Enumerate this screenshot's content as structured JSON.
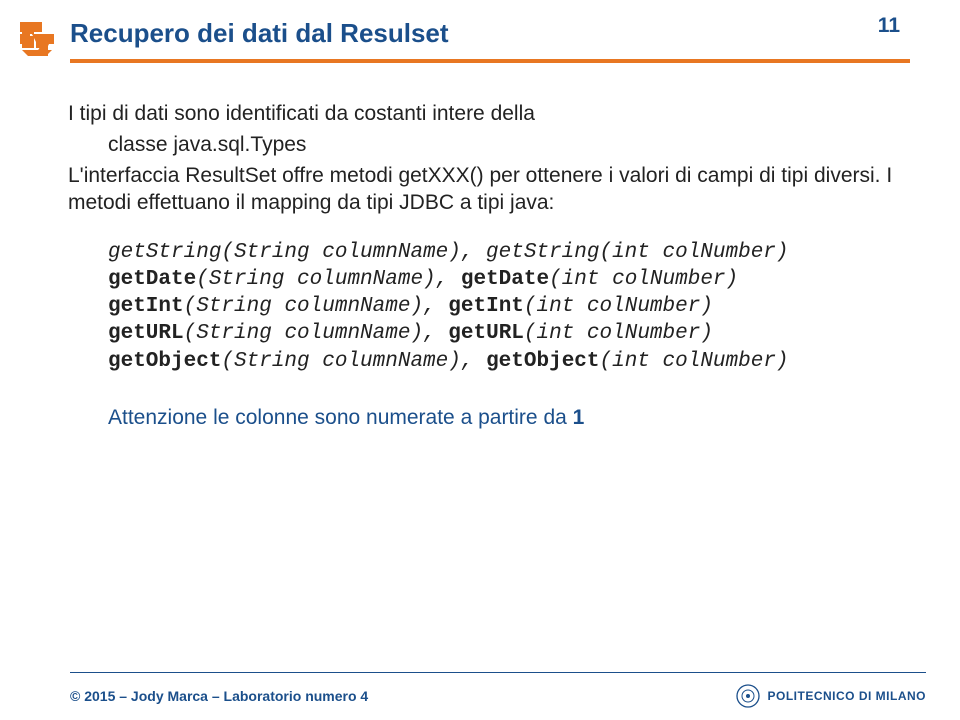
{
  "header": {
    "title": "Recupero dei dati dal Resulset",
    "page_number": "11"
  },
  "content": {
    "intro1": "I tipi di dati sono identificati da costanti intere della",
    "intro2": "classe java.sql.Types",
    "intro3": "L'interfaccia ResultSet offre metodi getXXX() per ottenere i valori di campi di tipi diversi. I metodi effettuano il mapping da tipi JDBC a tipi java:",
    "code": {
      "l1a": "getString(String columnName), getString(int colNumber)",
      "l2_pre": "getDate",
      "l2_mid": "(String columnName), ",
      "l2_b2": "getDate",
      "l2_end": "(int colNumber)",
      "l3_pre": "getInt",
      "l3_mid": "(String columnName), ",
      "l3_b2": "getInt",
      "l3_end": "(int colNumber)",
      "l4_pre": "getURL",
      "l4_mid": "(String columnName), ",
      "l4_b2": "getURL",
      "l4_end": "(int colNumber)",
      "l5_pre": "getObject",
      "l5_mid": "(String columnName), ",
      "l5_b2": "getObject",
      "l5_end": "(int colNumber)"
    },
    "note_pre": "Attenzione le colonne sono numerate a partire da ",
    "note_bold": "1"
  },
  "footer": {
    "copyright_symbol": "©",
    "copyright_text": " 2015 – Jody Marca – Laboratorio numero 4",
    "brand": "POLITECNICO DI MILANO"
  }
}
